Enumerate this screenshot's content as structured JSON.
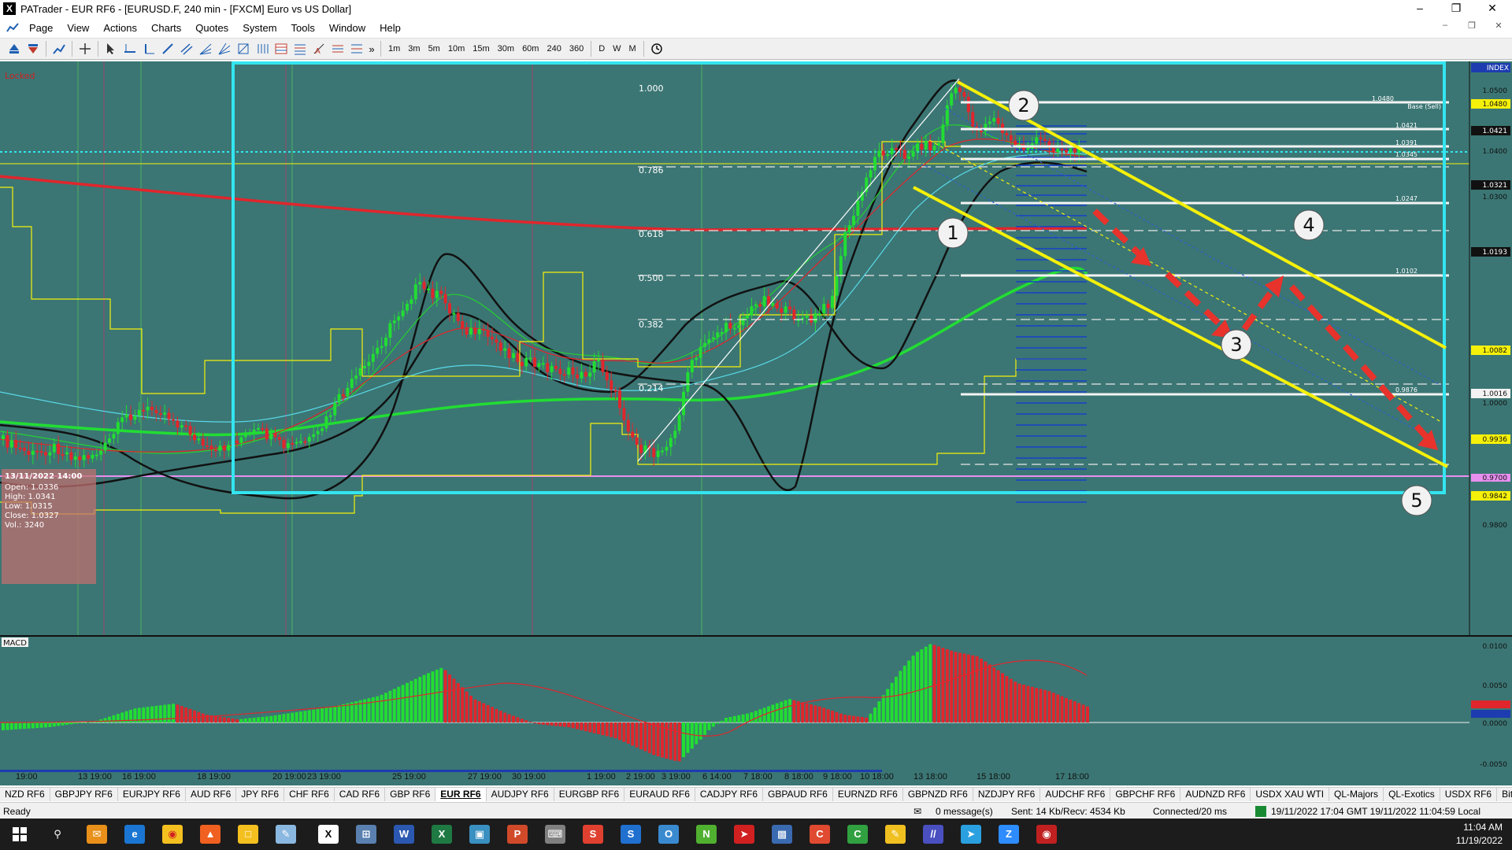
{
  "window": {
    "title": "PATrader - EUR RF6 - [EURUSD.F, 240 min - [FXCM] Euro vs US Dollar]",
    "app_icon": "X",
    "controls": [
      "minimize-icon",
      "maximize-icon",
      "close-icon"
    ]
  },
  "menu": [
    "Page",
    "View",
    "Actions",
    "Charts",
    "Quotes",
    "System",
    "Tools",
    "Window",
    "Help"
  ],
  "toolbar": {
    "timeframes": [
      "1m",
      "3m",
      "5m",
      "10m",
      "15m",
      "30m",
      "60m",
      "240",
      "360"
    ],
    "periods": [
      "D",
      "W",
      "M"
    ]
  },
  "chart": {
    "locked_label": "Locked",
    "index_label": "INDEX",
    "macd_label": "MACD",
    "info_box": {
      "date": "13/11/2022 14:00",
      "open": "Open: 1.0336",
      "high": "High: 1.0341",
      "low": "Low: 1.0315",
      "close": "Close: 1.0327",
      "vol": "Vol.: 3240"
    },
    "price_axis": [
      "1.0500",
      "1.0480",
      "1.0421",
      "1.0400",
      "1.0321",
      "1.0300",
      "1.0193",
      "1.0082",
      "1.0016",
      "1.0000",
      "0.9936",
      "0.9842",
      "0.9800",
      "0.9700"
    ],
    "fib_levels": [
      "1.000",
      "0.786",
      "0.618",
      "0.500",
      "0.382",
      "0.214"
    ],
    "pivot_labels": [
      "1.0480",
      "1.0421",
      "1.0391",
      "1.0345",
      "1.0247",
      "1.0102",
      "0.9876"
    ],
    "base_label": "Base (Sell)",
    "wave_labels": [
      "1",
      "2",
      "3",
      "4",
      "5"
    ],
    "macd_axis": [
      "0.0100",
      "0.0050",
      "0.0000",
      "-0.0050"
    ],
    "time_axis": [
      "19:00",
      "13 19:00",
      "16 19:00",
      "18 19:00",
      "20 19:00",
      "23 19:00",
      "25 19:00",
      "27 19:00",
      "30 19:00",
      "1 19:00",
      "2 19:00",
      "3 19:00",
      "6 14:00",
      "7 18:00",
      "8 18:00",
      "9 18:00",
      "10 18:00",
      "13 18:00",
      "15 18:00",
      "17 18:00"
    ],
    "colors": {
      "background": "#3b7674",
      "bull": "#22dd33",
      "bear": "#e0262c",
      "box": "#33e5f0",
      "channel": "#f5f00a",
      "ma_red": "#e0262c",
      "ma_green": "#22dd33"
    }
  },
  "symbol_tabs": [
    "NZD RF6",
    "GBPJPY RF6",
    "EURJPY RF6",
    "AUD RF6",
    "JPY RF6",
    "CHF RF6",
    "CAD RF6",
    "GBP RF6",
    "EUR RF6",
    "AUDJPY RF6",
    "EURGBP RF6",
    "EURAUD RF6",
    "CADJPY RF6",
    "GBPAUD RF6",
    "EURNZD RF6",
    "GBPNZD RF6",
    "NZDJPY RF6",
    "AUDCHF RF6",
    "GBPCHF RF6",
    "AUDNZD RF6",
    "USDX XAU WTI",
    "QL-Majors",
    "QL-Exotics",
    "USDX RF6",
    "Bitcoin"
  ],
  "active_tab": "EUR RF6",
  "status": {
    "ready": "Ready",
    "messages": "0 message(s)",
    "traffic": "Sent: 14 Kb/Recv: 4534 Kb",
    "connection": "Connected/20 ms",
    "datetime": "19/11/2022 17:04 GMT  19/11/2022 11:04:59 Local"
  },
  "taskbar": {
    "time": "11:04 AM",
    "date": "11/19/2022"
  }
}
